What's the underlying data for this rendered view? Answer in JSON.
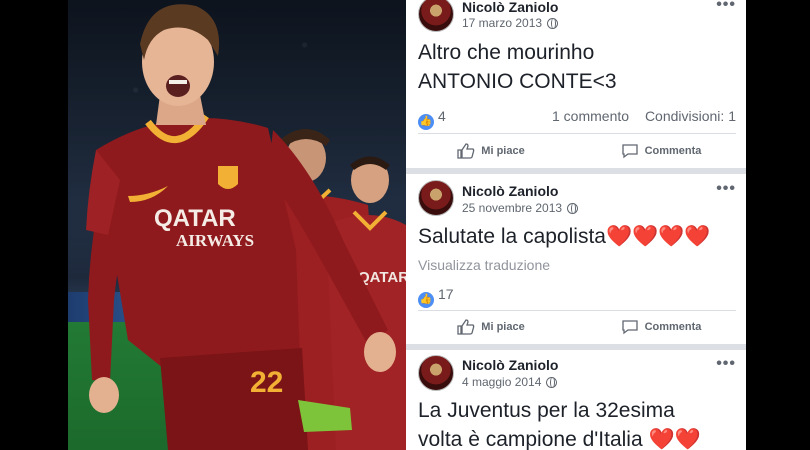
{
  "photo": {
    "sponsor_line1": "QATAR",
    "sponsor_line2": "AIRWAYS",
    "shirt_number": "22",
    "background_sponsor": "QATAR"
  },
  "posts": [
    {
      "author": "Nicolò Zaniolo",
      "date": "17 marzo 2013",
      "text_lines": [
        "Altro che mourinho",
        "ANTONIO CONTE<3"
      ],
      "likes": "4",
      "comments": "1 commento",
      "shares": "Condivisioni: 1",
      "like_label": "Mi piace",
      "comment_label": "Commenta"
    },
    {
      "author": "Nicolò Zaniolo",
      "date": "25 novembre 2013",
      "text": "Salutate la capolista❤️❤️❤️❤️",
      "translate_label": "Visualizza traduzione",
      "likes": "17",
      "like_label": "Mi piace",
      "comment_label": "Commenta"
    },
    {
      "author": "Nicolò Zaniolo",
      "date": "4 maggio 2014",
      "text_lines": [
        "La Juventus per la 32esima",
        "volta è campione d'Italia ❤️❤️"
      ]
    }
  ],
  "colors": {
    "jersey": "#8f1a1d",
    "jersey_trim": "#f2b134",
    "facebook_blue": "#4d8ef5"
  }
}
